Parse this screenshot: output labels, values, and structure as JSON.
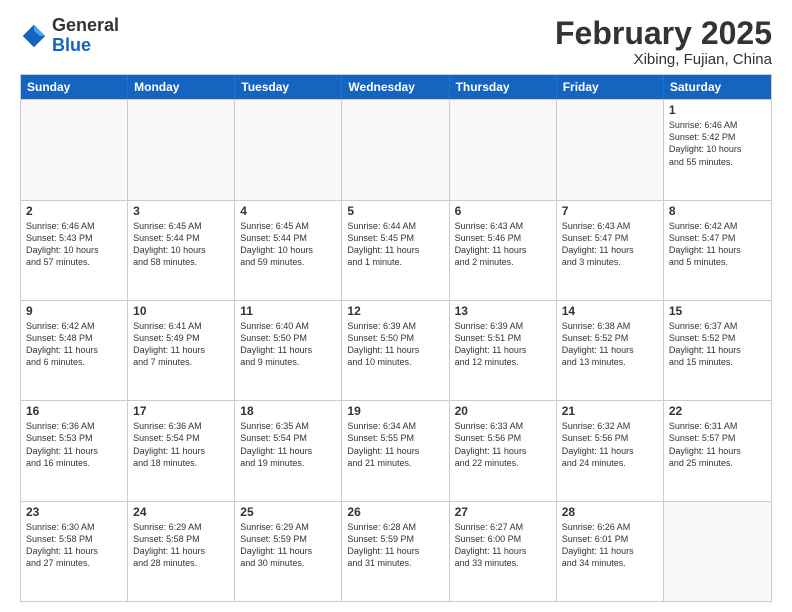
{
  "logo": {
    "general": "General",
    "blue": "Blue"
  },
  "title": "February 2025",
  "subtitle": "Xibing, Fujian, China",
  "header_days": [
    "Sunday",
    "Monday",
    "Tuesday",
    "Wednesday",
    "Thursday",
    "Friday",
    "Saturday"
  ],
  "weeks": [
    [
      {
        "day": "",
        "info": ""
      },
      {
        "day": "",
        "info": ""
      },
      {
        "day": "",
        "info": ""
      },
      {
        "day": "",
        "info": ""
      },
      {
        "day": "",
        "info": ""
      },
      {
        "day": "",
        "info": ""
      },
      {
        "day": "1",
        "info": "Sunrise: 6:46 AM\nSunset: 5:42 PM\nDaylight: 10 hours\nand 55 minutes."
      }
    ],
    [
      {
        "day": "2",
        "info": "Sunrise: 6:46 AM\nSunset: 5:43 PM\nDaylight: 10 hours\nand 57 minutes."
      },
      {
        "day": "3",
        "info": "Sunrise: 6:45 AM\nSunset: 5:44 PM\nDaylight: 10 hours\nand 58 minutes."
      },
      {
        "day": "4",
        "info": "Sunrise: 6:45 AM\nSunset: 5:44 PM\nDaylight: 10 hours\nand 59 minutes."
      },
      {
        "day": "5",
        "info": "Sunrise: 6:44 AM\nSunset: 5:45 PM\nDaylight: 11 hours\nand 1 minute."
      },
      {
        "day": "6",
        "info": "Sunrise: 6:43 AM\nSunset: 5:46 PM\nDaylight: 11 hours\nand 2 minutes."
      },
      {
        "day": "7",
        "info": "Sunrise: 6:43 AM\nSunset: 5:47 PM\nDaylight: 11 hours\nand 3 minutes."
      },
      {
        "day": "8",
        "info": "Sunrise: 6:42 AM\nSunset: 5:47 PM\nDaylight: 11 hours\nand 5 minutes."
      }
    ],
    [
      {
        "day": "9",
        "info": "Sunrise: 6:42 AM\nSunset: 5:48 PM\nDaylight: 11 hours\nand 6 minutes."
      },
      {
        "day": "10",
        "info": "Sunrise: 6:41 AM\nSunset: 5:49 PM\nDaylight: 11 hours\nand 7 minutes."
      },
      {
        "day": "11",
        "info": "Sunrise: 6:40 AM\nSunset: 5:50 PM\nDaylight: 11 hours\nand 9 minutes."
      },
      {
        "day": "12",
        "info": "Sunrise: 6:39 AM\nSunset: 5:50 PM\nDaylight: 11 hours\nand 10 minutes."
      },
      {
        "day": "13",
        "info": "Sunrise: 6:39 AM\nSunset: 5:51 PM\nDaylight: 11 hours\nand 12 minutes."
      },
      {
        "day": "14",
        "info": "Sunrise: 6:38 AM\nSunset: 5:52 PM\nDaylight: 11 hours\nand 13 minutes."
      },
      {
        "day": "15",
        "info": "Sunrise: 6:37 AM\nSunset: 5:52 PM\nDaylight: 11 hours\nand 15 minutes."
      }
    ],
    [
      {
        "day": "16",
        "info": "Sunrise: 6:36 AM\nSunset: 5:53 PM\nDaylight: 11 hours\nand 16 minutes."
      },
      {
        "day": "17",
        "info": "Sunrise: 6:36 AM\nSunset: 5:54 PM\nDaylight: 11 hours\nand 18 minutes."
      },
      {
        "day": "18",
        "info": "Sunrise: 6:35 AM\nSunset: 5:54 PM\nDaylight: 11 hours\nand 19 minutes."
      },
      {
        "day": "19",
        "info": "Sunrise: 6:34 AM\nSunset: 5:55 PM\nDaylight: 11 hours\nand 21 minutes."
      },
      {
        "day": "20",
        "info": "Sunrise: 6:33 AM\nSunset: 5:56 PM\nDaylight: 11 hours\nand 22 minutes."
      },
      {
        "day": "21",
        "info": "Sunrise: 6:32 AM\nSunset: 5:56 PM\nDaylight: 11 hours\nand 24 minutes."
      },
      {
        "day": "22",
        "info": "Sunrise: 6:31 AM\nSunset: 5:57 PM\nDaylight: 11 hours\nand 25 minutes."
      }
    ],
    [
      {
        "day": "23",
        "info": "Sunrise: 6:30 AM\nSunset: 5:58 PM\nDaylight: 11 hours\nand 27 minutes."
      },
      {
        "day": "24",
        "info": "Sunrise: 6:29 AM\nSunset: 5:58 PM\nDaylight: 11 hours\nand 28 minutes."
      },
      {
        "day": "25",
        "info": "Sunrise: 6:29 AM\nSunset: 5:59 PM\nDaylight: 11 hours\nand 30 minutes."
      },
      {
        "day": "26",
        "info": "Sunrise: 6:28 AM\nSunset: 5:59 PM\nDaylight: 11 hours\nand 31 minutes."
      },
      {
        "day": "27",
        "info": "Sunrise: 6:27 AM\nSunset: 6:00 PM\nDaylight: 11 hours\nand 33 minutes."
      },
      {
        "day": "28",
        "info": "Sunrise: 6:26 AM\nSunset: 6:01 PM\nDaylight: 11 hours\nand 34 minutes."
      },
      {
        "day": "",
        "info": ""
      }
    ]
  ]
}
